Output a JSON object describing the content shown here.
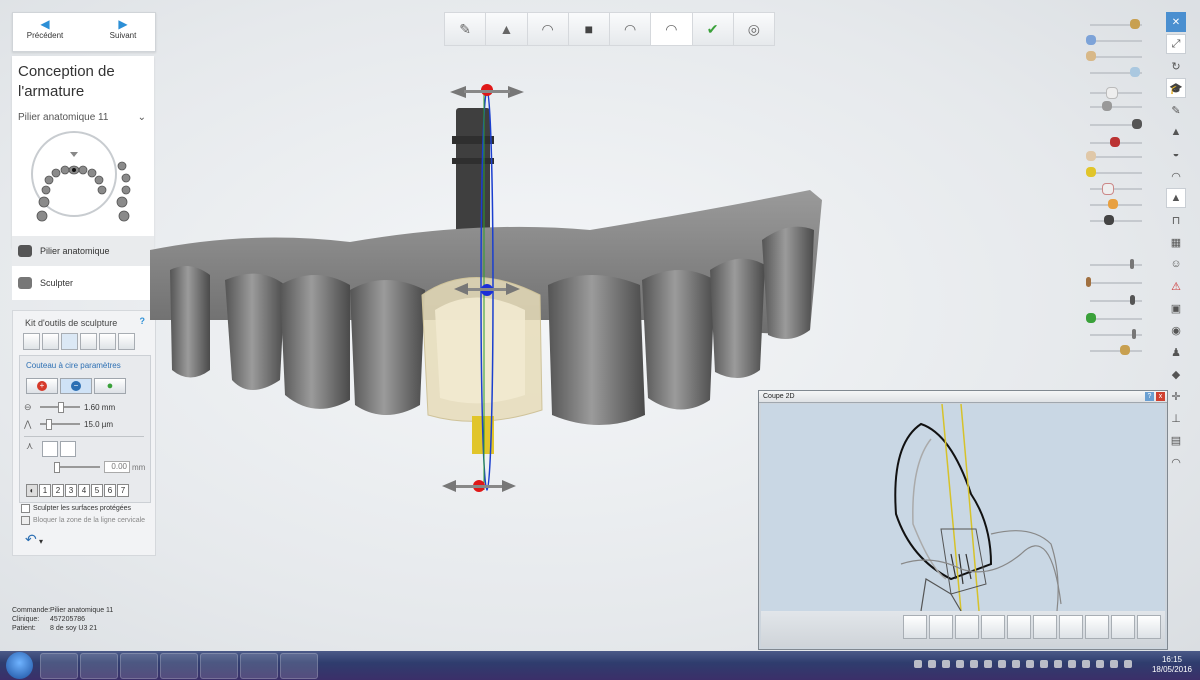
{
  "nav": {
    "prev_label": "Précédent",
    "next_label": "Suivant"
  },
  "panel": {
    "title_line1": "Conception de",
    "title_line2": "l'armature",
    "dropdown_value": "Pilier anatomique 11",
    "steps": [
      {
        "label": "Pilier anatomique"
      },
      {
        "label": "Sculpter"
      }
    ]
  },
  "kit": {
    "header": "Kit d'outils de sculpture",
    "help": "?",
    "section_label": "Couteau à cire paramètres",
    "size_value": "1.60 mm",
    "thickness_value": "15.0 µm",
    "offset_value": "0.00",
    "offset_unit": "mm",
    "num_buttons": [
      "1",
      "2",
      "3",
      "4",
      "5",
      "6",
      "7"
    ],
    "check1": "Sculpter les surfaces protégées",
    "check2": "Bloquer la zone de la ligne cervicale",
    "colors": {
      "accent": "#2c8fd6",
      "red": "#d63a2a",
      "green": "#3aa13a"
    }
  },
  "info": {
    "command_label": "Commande:",
    "command_value": "Pilier anatomique 11",
    "clinic_label": "Clinique:",
    "clinic_value": "457205786",
    "patient_label": "Patient:",
    "patient_value": "8 de soy U3 21"
  },
  "coupe": {
    "title": "Coupe 2D",
    "help": "?",
    "close": "x"
  },
  "taskbar": {
    "time": "16:15",
    "date": "18/05/2016"
  }
}
